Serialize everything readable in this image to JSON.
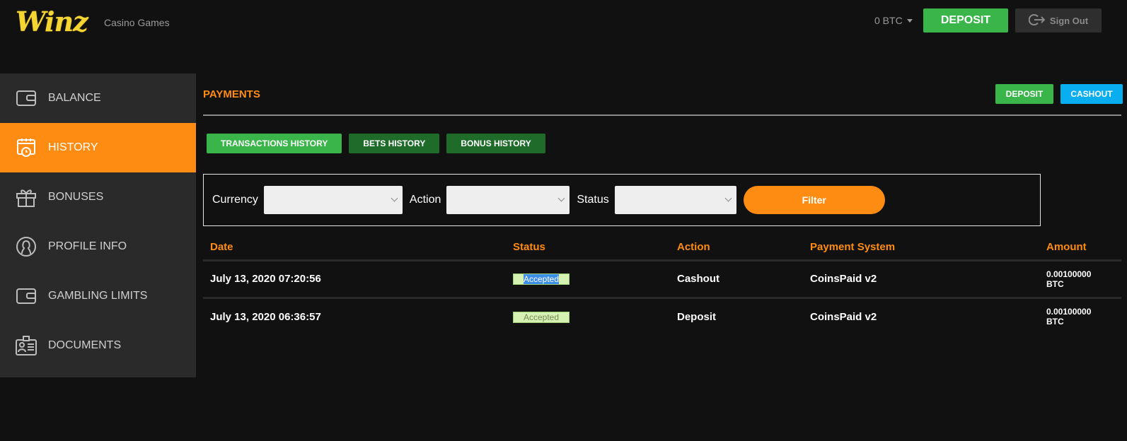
{
  "header": {
    "logo": "Winz",
    "nav_link": "Casino Games",
    "balance": "0 BTC",
    "deposit_label": "DEPOSIT",
    "signout_label": "Sign Out"
  },
  "sidebar": {
    "items": [
      {
        "label": "BALANCE",
        "icon": "wallet-icon",
        "active": false
      },
      {
        "label": "HISTORY",
        "icon": "calendar-clock-icon",
        "active": true
      },
      {
        "label": "BONUSES",
        "icon": "gift-icon",
        "active": false
      },
      {
        "label": "PROFILE INFO",
        "icon": "user-circle-icon",
        "active": false
      },
      {
        "label": "GAMBLING LIMITS",
        "icon": "wallet-icon",
        "active": false
      },
      {
        "label": "DOCUMENTS",
        "icon": "id-card-icon",
        "active": false
      }
    ]
  },
  "main": {
    "title": "PAYMENTS",
    "deposit_label": "DEPOSIT",
    "cashout_label": "CASHOUT",
    "tabs": [
      {
        "label": "TRANSACTIONS HISTORY",
        "active": true
      },
      {
        "label": "BETS HISTORY",
        "active": false
      },
      {
        "label": "BONUS HISTORY",
        "active": false
      }
    ],
    "filter": {
      "currency_label": "Currency",
      "currency_value": "",
      "action_label": "Action",
      "action_value": "",
      "status_label": "Status",
      "status_value": "",
      "button_label": "Filter"
    },
    "table": {
      "columns": [
        "Date",
        "Status",
        "Action",
        "Payment System",
        "Amount"
      ],
      "rows": [
        {
          "date": "July 13, 2020 07:20:56",
          "status": "Accepted",
          "action": "Cashout",
          "payment_system": "CoinsPaid v2",
          "amount": "0.00100000",
          "currency": "BTC"
        },
        {
          "date": "July 13, 2020 06:36:57",
          "status": "Accepted",
          "action": "Deposit",
          "payment_system": "CoinsPaid v2",
          "amount": "0.00100000",
          "currency": "BTC"
        }
      ]
    }
  },
  "colors": {
    "accent": "#ff8c12",
    "green": "#39b54a",
    "dark_green": "#1f6b2a",
    "blue": "#09aef0",
    "logo": "#f5d531"
  }
}
